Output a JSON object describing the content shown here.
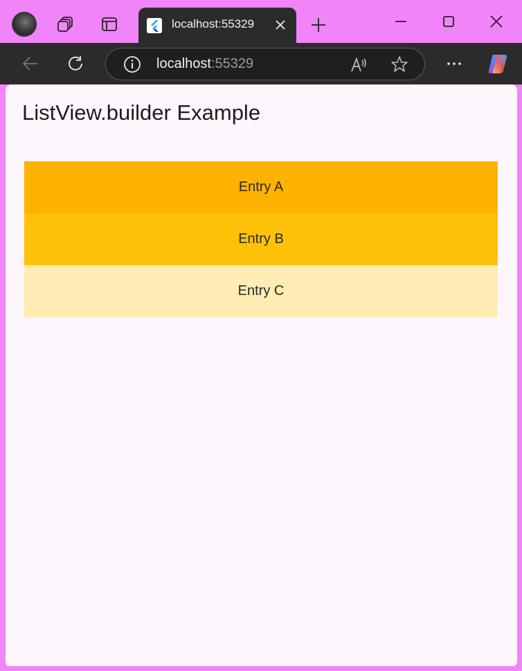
{
  "browser": {
    "tab_title": "localhost:55329",
    "url_host": "localhost",
    "url_port": ":55329",
    "icons": [
      "profile-avatar",
      "workspaces-icon",
      "vertical-tabs-icon",
      "flutter-favicon",
      "close-icon",
      "plus-icon",
      "minimize-icon",
      "maximize-icon",
      "back-arrow-icon",
      "refresh-icon",
      "info-icon",
      "read-aloud-icon",
      "star-icon",
      "more-icon",
      "copilot-icon"
    ]
  },
  "app": {
    "title": "ListView.builder Example",
    "entries": [
      {
        "label": "Entry A",
        "color": "#ffb300"
      },
      {
        "label": "Entry B",
        "color": "#ffc107"
      },
      {
        "label": "Entry C",
        "color": "#ffecb3"
      }
    ]
  }
}
